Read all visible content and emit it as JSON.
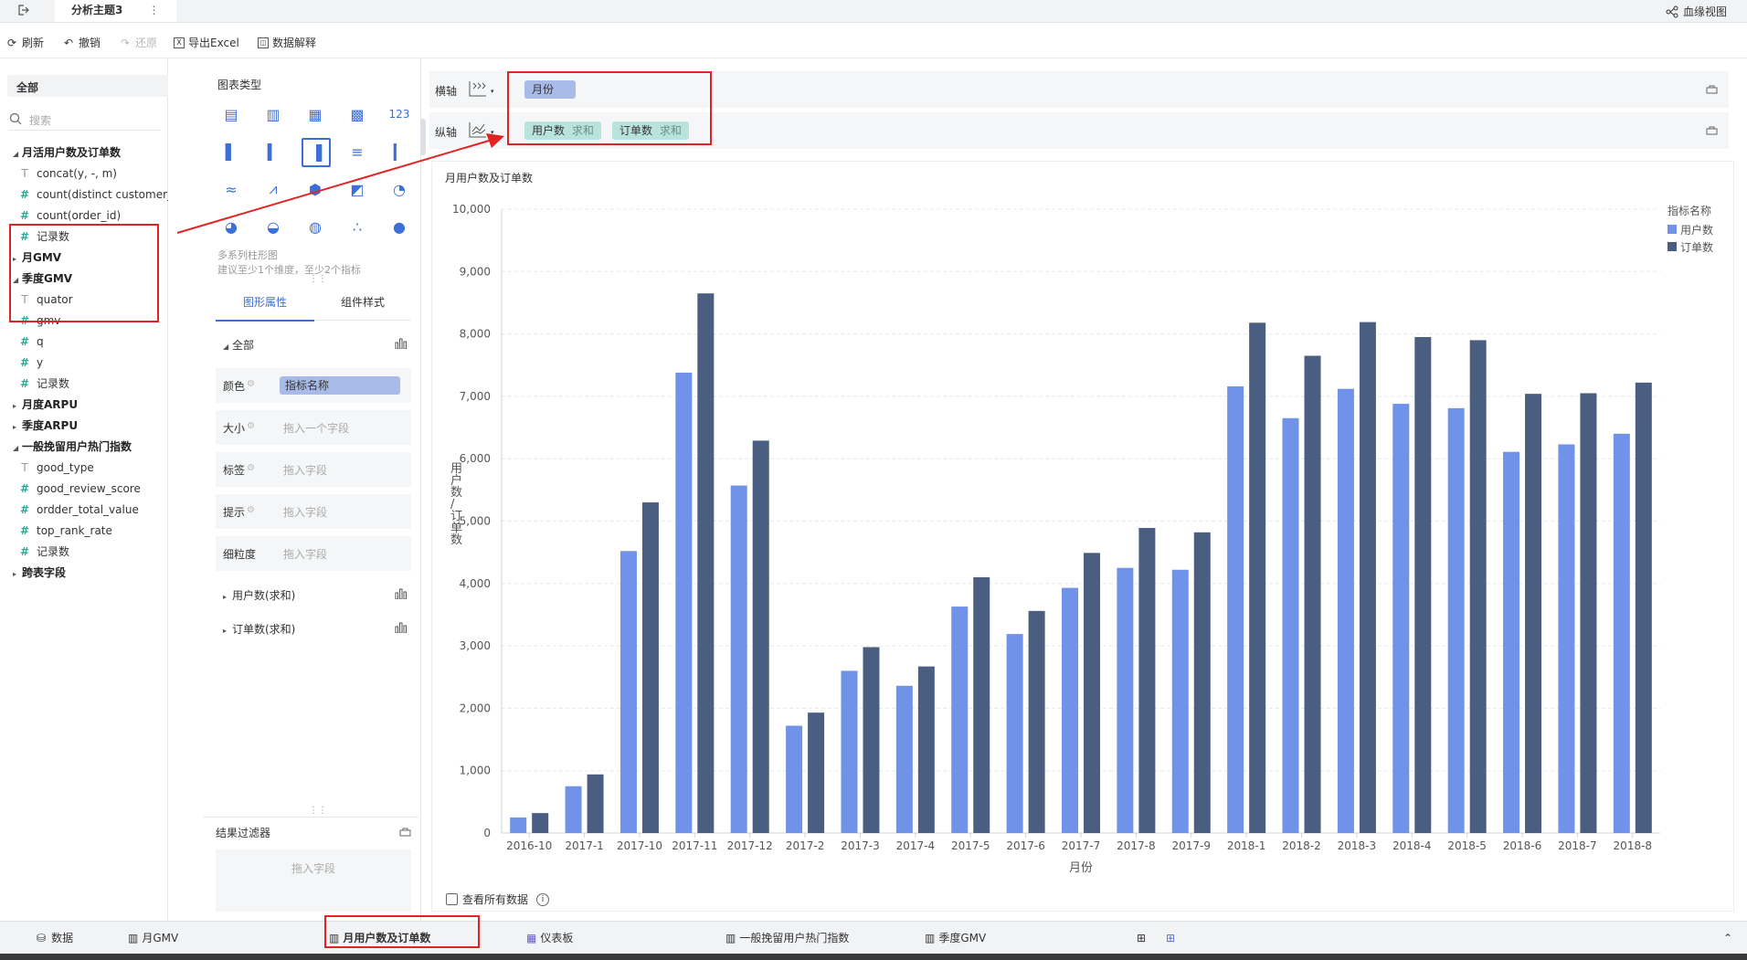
{
  "topbar": {
    "tab_title": "分析主题3",
    "lineage_label": "血缘视图"
  },
  "toolbar": {
    "refresh": "刷新",
    "undo": "撤销",
    "redo": "还原",
    "export": "导出Excel",
    "explain": "数据解释"
  },
  "fields": {
    "select_value": "全部",
    "search_placeholder": "搜索",
    "groups": [
      {
        "name": "月活用户数及订单数",
        "expanded": true,
        "items": [
          {
            "type": "T",
            "name": "concat(y, -, m)"
          },
          {
            "type": "#",
            "name": "count(distinct customer_id)"
          },
          {
            "type": "#",
            "name": "count(order_id)"
          },
          {
            "type": "#",
            "name": "记录数"
          }
        ]
      },
      {
        "name": "月GMV",
        "expanded": false,
        "items": []
      },
      {
        "name": "季度GMV",
        "expanded": true,
        "items": [
          {
            "type": "T",
            "name": "quator"
          },
          {
            "type": "#",
            "name": "gmv"
          },
          {
            "type": "#",
            "name": "q"
          },
          {
            "type": "#",
            "name": "y"
          },
          {
            "type": "#",
            "name": "记录数"
          }
        ]
      },
      {
        "name": "月度ARPU",
        "expanded": false,
        "items": []
      },
      {
        "name": "季度ARPU",
        "expanded": false,
        "items": []
      },
      {
        "name": "一般挽留用户热门指数",
        "expanded": true,
        "items": [
          {
            "type": "T",
            "name": "good_type"
          },
          {
            "type": "#",
            "name": "good_review_score"
          },
          {
            "type": "#",
            "name": "ordder_total_value"
          },
          {
            "type": "#",
            "name": "top_rank_rate"
          },
          {
            "type": "#",
            "name": "记录数"
          }
        ]
      },
      {
        "name": "跨表字段",
        "expanded": false,
        "items": []
      }
    ]
  },
  "config": {
    "chart_type_title": "图表类型",
    "chart_desc_1": "多系列柱形图",
    "chart_desc_2": "建议至少1个维度，至少2个指标",
    "tab_graph": "图形属性",
    "tab_style": "组件样式",
    "all_label": "全部",
    "props": [
      {
        "label": "颜色",
        "value": "指标名称"
      },
      {
        "label": "大小",
        "value": "拖入一个字段"
      },
      {
        "label": "标签",
        "value": "拖入字段"
      },
      {
        "label": "提示",
        "value": "拖入字段"
      },
      {
        "label": "细粒度",
        "value": "拖入字段"
      }
    ],
    "measure_1": "用户数(求和)",
    "measure_2": "订单数(求和)",
    "filter_title": "结果过滤器",
    "filter_placeholder": "拖入字段"
  },
  "axes": {
    "x_label": "横轴",
    "x_pill": "月份",
    "y_label": "纵轴",
    "y_pill_1": "用户数",
    "y_pill_1_agg": "求和",
    "y_pill_2": "订单数",
    "y_pill_2_agg": "求和"
  },
  "show_all_data": "查看所有数据",
  "bottom_tabs": [
    "数据",
    "月GMV",
    "月用户数及订单数",
    "仪表板",
    "一般挽留用户热门指数",
    "季度GMV"
  ],
  "colors": {
    "series1": "#7092e8",
    "series2": "#4a5e82",
    "accent": "#3d6fd8",
    "highlight": "#e02424"
  },
  "chart_data": {
    "type": "bar",
    "title": "月用户数及订单数",
    "xlabel": "月份",
    "ylabel": "用户数/订单数",
    "ylim": [
      0,
      10000
    ],
    "yticks": [
      "0",
      "1,000",
      "2,000",
      "3,000",
      "4,000",
      "5,000",
      "6,000",
      "7,000",
      "8,000",
      "9,000",
      "10,000"
    ],
    "legend_title": "指标名称",
    "legend_position": "top-right",
    "grid": true,
    "categories": [
      "2016-10",
      "2017-1",
      "2017-10",
      "2017-11",
      "2017-12",
      "2017-2",
      "2017-3",
      "2017-4",
      "2017-5",
      "2017-6",
      "2017-7",
      "2017-8",
      "2017-9",
      "2018-1",
      "2018-2",
      "2018-3",
      "2018-4",
      "2018-5",
      "2018-6",
      "2018-7",
      "2018-8"
    ],
    "series": [
      {
        "name": "用户数",
        "values": [
          250,
          750,
          4520,
          7380,
          5570,
          1720,
          2600,
          2360,
          3630,
          3190,
          3930,
          4250,
          4220,
          7160,
          6650,
          7120,
          6880,
          6810,
          6110,
          6230,
          6400
        ]
      },
      {
        "name": "订单数",
        "values": [
          320,
          940,
          5300,
          8650,
          6290,
          1930,
          2980,
          2670,
          4100,
          3560,
          4490,
          4890,
          4820,
          8180,
          7650,
          8190,
          7950,
          7900,
          7040,
          7050,
          7220
        ]
      }
    ]
  }
}
